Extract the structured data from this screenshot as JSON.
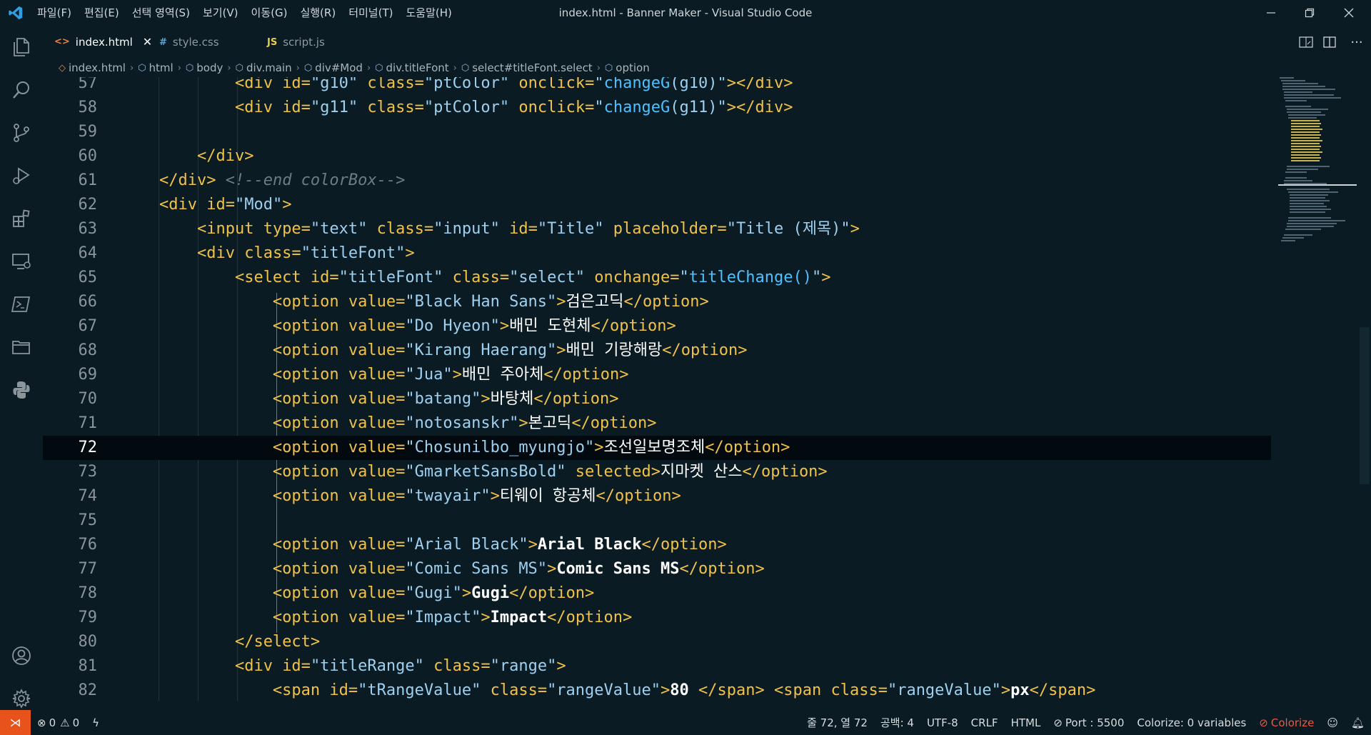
{
  "titlebar": {
    "menu": [
      "파일(F)",
      "편집(E)",
      "선택 영역(S)",
      "보기(V)",
      "이동(G)",
      "실행(R)",
      "터미널(T)",
      "도움말(H)"
    ],
    "title": "index.html - Banner Maker - Visual Studio Code"
  },
  "tabs": [
    {
      "label": "index.html",
      "icon": "<>",
      "active": true,
      "icon_color": "#e8804a"
    },
    {
      "label": "style.css",
      "icon": "#",
      "active": false,
      "icon_color": "#5aa7d6"
    },
    {
      "label": "script.js",
      "icon": "JS",
      "active": false,
      "icon_color": "#e8cf4d"
    }
  ],
  "breadcrumb": [
    "index.html",
    "html",
    "body",
    "div.main",
    "div#Mod",
    "div.titleFont",
    "select#titleFont.select",
    "option"
  ],
  "editor": {
    "current_line": "72",
    "lines": [
      {
        "n": "57",
        "c": [
          [
            "t-txt",
            "            "
          ],
          [
            "t-tag",
            "<div "
          ],
          [
            "t-attr",
            "id="
          ],
          [
            "t-str",
            "\"g10\""
          ],
          [
            "t-attr",
            " class="
          ],
          [
            "t-str",
            "\"ptColor\""
          ],
          [
            "t-attr",
            " onclick="
          ],
          [
            "t-str",
            "\""
          ],
          [
            "t-fn",
            "changeG"
          ],
          [
            "t-str",
            "(g10)\""
          ],
          [
            "t-tag",
            "></div>"
          ]
        ]
      },
      {
        "n": "58",
        "c": [
          [
            "t-txt",
            "            "
          ],
          [
            "t-tag",
            "<div "
          ],
          [
            "t-attr",
            "id="
          ],
          [
            "t-str",
            "\"g11\""
          ],
          [
            "t-attr",
            " class="
          ],
          [
            "t-str",
            "\"ptColor\""
          ],
          [
            "t-attr",
            " onclick="
          ],
          [
            "t-str",
            "\""
          ],
          [
            "t-fn",
            "changeG"
          ],
          [
            "t-str",
            "(g11)\""
          ],
          [
            "t-tag",
            "></div>"
          ]
        ]
      },
      {
        "n": "59",
        "c": []
      },
      {
        "n": "60",
        "c": [
          [
            "t-txt",
            "        "
          ],
          [
            "t-tag",
            "</div>"
          ]
        ]
      },
      {
        "n": "61",
        "c": [
          [
            "t-txt",
            "    "
          ],
          [
            "t-tag",
            "</div>"
          ],
          [
            "t-txt",
            " "
          ],
          [
            "t-com",
            "<!--end colorBox-->"
          ]
        ]
      },
      {
        "n": "62",
        "c": [
          [
            "t-txt",
            "    "
          ],
          [
            "t-tag",
            "<div "
          ],
          [
            "t-attr",
            "id="
          ],
          [
            "t-str",
            "\"Mod\""
          ],
          [
            "t-tag",
            ">"
          ]
        ]
      },
      {
        "n": "63",
        "c": [
          [
            "t-txt",
            "        "
          ],
          [
            "t-tag",
            "<input "
          ],
          [
            "t-attr",
            "type="
          ],
          [
            "t-str",
            "\"text\""
          ],
          [
            "t-attr",
            " class="
          ],
          [
            "t-str",
            "\"input\""
          ],
          [
            "t-attr",
            " id="
          ],
          [
            "t-str",
            "\"Title\""
          ],
          [
            "t-attr",
            " placeholder="
          ],
          [
            "t-str",
            "\"Title (제목)\""
          ],
          [
            "t-tag",
            ">"
          ]
        ]
      },
      {
        "n": "64",
        "c": [
          [
            "t-txt",
            "        "
          ],
          [
            "t-tag",
            "<div "
          ],
          [
            "t-attr",
            "class="
          ],
          [
            "t-str",
            "\"titleFont\""
          ],
          [
            "t-tag",
            ">"
          ]
        ]
      },
      {
        "n": "65",
        "c": [
          [
            "t-txt",
            "            "
          ],
          [
            "t-tag",
            "<select "
          ],
          [
            "t-attr",
            "id="
          ],
          [
            "t-str",
            "\"titleFont\""
          ],
          [
            "t-attr",
            " class="
          ],
          [
            "t-str",
            "\"select\""
          ],
          [
            "t-attr",
            " onchange="
          ],
          [
            "t-str",
            "\""
          ],
          [
            "t-fn",
            "titleChange()"
          ],
          [
            "t-str",
            "\""
          ],
          [
            "t-tag",
            ">"
          ]
        ]
      },
      {
        "n": "66",
        "c": [
          [
            "t-txt",
            "                "
          ],
          [
            "t-tag",
            "<option "
          ],
          [
            "t-attr",
            "value="
          ],
          [
            "t-str",
            "\"Black Han Sans\""
          ],
          [
            "t-tag",
            ">"
          ],
          [
            "t-txt",
            "검은고딕"
          ],
          [
            "t-tag",
            "</option>"
          ]
        ]
      },
      {
        "n": "67",
        "c": [
          [
            "t-txt",
            "                "
          ],
          [
            "t-tag",
            "<option "
          ],
          [
            "t-attr",
            "value="
          ],
          [
            "t-str",
            "\"Do Hyeon\""
          ],
          [
            "t-tag",
            ">"
          ],
          [
            "t-txt",
            "배민 도현체"
          ],
          [
            "t-tag",
            "</option>"
          ]
        ]
      },
      {
        "n": "68",
        "c": [
          [
            "t-txt",
            "                "
          ],
          [
            "t-tag",
            "<option "
          ],
          [
            "t-attr",
            "value="
          ],
          [
            "t-str",
            "\"Kirang Haerang\""
          ],
          [
            "t-tag",
            ">"
          ],
          [
            "t-txt",
            "배민 기랑해랑"
          ],
          [
            "t-tag",
            "</option>"
          ]
        ]
      },
      {
        "n": "69",
        "c": [
          [
            "t-txt",
            "                "
          ],
          [
            "t-tag",
            "<option "
          ],
          [
            "t-attr",
            "value="
          ],
          [
            "t-str",
            "\"Jua\""
          ],
          [
            "t-tag",
            ">"
          ],
          [
            "t-txt",
            "배민 주아체"
          ],
          [
            "t-tag",
            "</option>"
          ]
        ]
      },
      {
        "n": "70",
        "c": [
          [
            "t-txt",
            "                "
          ],
          [
            "t-tag",
            "<option "
          ],
          [
            "t-attr",
            "value="
          ],
          [
            "t-str",
            "\"batang\""
          ],
          [
            "t-tag",
            ">"
          ],
          [
            "t-txt",
            "바탕체"
          ],
          [
            "t-tag",
            "</option>"
          ]
        ]
      },
      {
        "n": "71",
        "c": [
          [
            "t-txt",
            "                "
          ],
          [
            "t-tag",
            "<option "
          ],
          [
            "t-attr",
            "value="
          ],
          [
            "t-str",
            "\"notosanskr\""
          ],
          [
            "t-tag",
            ">"
          ],
          [
            "t-txt",
            "본고딕"
          ],
          [
            "t-tag",
            "</option>"
          ]
        ]
      },
      {
        "n": "72",
        "c": [
          [
            "t-txt",
            "                "
          ],
          [
            "t-tag",
            "<option "
          ],
          [
            "t-attr",
            "value="
          ],
          [
            "t-str",
            "\"Chosunilbo_myungjo\""
          ],
          [
            "t-tag",
            ">"
          ],
          [
            "t-txt",
            "조선일보명조체"
          ],
          [
            "t-tag",
            "</option>"
          ]
        ]
      },
      {
        "n": "73",
        "c": [
          [
            "t-txt",
            "                "
          ],
          [
            "t-tag",
            "<option "
          ],
          [
            "t-attr",
            "value="
          ],
          [
            "t-str",
            "\"GmarketSansBold\""
          ],
          [
            "t-attr",
            " selected"
          ],
          [
            "t-tag",
            ">"
          ],
          [
            "t-txt",
            "지마켓 산스"
          ],
          [
            "t-tag",
            "</option>"
          ]
        ]
      },
      {
        "n": "74",
        "c": [
          [
            "t-txt",
            "                "
          ],
          [
            "t-tag",
            "<option "
          ],
          [
            "t-attr",
            "value="
          ],
          [
            "t-str",
            "\"twayair\""
          ],
          [
            "t-tag",
            ">"
          ],
          [
            "t-txt",
            "티웨이 항공체"
          ],
          [
            "t-tag",
            "</option>"
          ]
        ]
      },
      {
        "n": "75",
        "c": []
      },
      {
        "n": "76",
        "c": [
          [
            "t-txt",
            "                "
          ],
          [
            "t-tag",
            "<option "
          ],
          [
            "t-attr",
            "value="
          ],
          [
            "t-str",
            "\"Arial Black\""
          ],
          [
            "t-tag",
            ">"
          ],
          [
            "t-b",
            "Arial Black"
          ],
          [
            "t-tag",
            "</option>"
          ]
        ]
      },
      {
        "n": "77",
        "c": [
          [
            "t-txt",
            "                "
          ],
          [
            "t-tag",
            "<option "
          ],
          [
            "t-attr",
            "value="
          ],
          [
            "t-str",
            "\"Comic Sans MS\""
          ],
          [
            "t-tag",
            ">"
          ],
          [
            "t-b",
            "Comic Sans MS"
          ],
          [
            "t-tag",
            "</option>"
          ]
        ]
      },
      {
        "n": "78",
        "c": [
          [
            "t-txt",
            "                "
          ],
          [
            "t-tag",
            "<option "
          ],
          [
            "t-attr",
            "value="
          ],
          [
            "t-str",
            "\"Gugi\""
          ],
          [
            "t-tag",
            ">"
          ],
          [
            "t-b",
            "Gugi"
          ],
          [
            "t-tag",
            "</option>"
          ]
        ]
      },
      {
        "n": "79",
        "c": [
          [
            "t-txt",
            "                "
          ],
          [
            "t-tag",
            "<option "
          ],
          [
            "t-attr",
            "value="
          ],
          [
            "t-str",
            "\"Impact\""
          ],
          [
            "t-tag",
            ">"
          ],
          [
            "t-b",
            "Impact"
          ],
          [
            "t-tag",
            "</option>"
          ]
        ]
      },
      {
        "n": "80",
        "c": [
          [
            "t-txt",
            "            "
          ],
          [
            "t-tag",
            "</select>"
          ]
        ]
      },
      {
        "n": "81",
        "c": [
          [
            "t-txt",
            "            "
          ],
          [
            "t-tag",
            "<div "
          ],
          [
            "t-attr",
            "id="
          ],
          [
            "t-str",
            "\"titleRange\""
          ],
          [
            "t-attr",
            " class="
          ],
          [
            "t-str",
            "\"range\""
          ],
          [
            "t-tag",
            ">"
          ]
        ]
      },
      {
        "n": "82",
        "c": [
          [
            "t-txt",
            "                "
          ],
          [
            "t-tag",
            "<span "
          ],
          [
            "t-attr",
            "id="
          ],
          [
            "t-str",
            "\"tRangeValue\""
          ],
          [
            "t-attr",
            " class="
          ],
          [
            "t-str",
            "\"rangeValue\""
          ],
          [
            "t-tag",
            ">"
          ],
          [
            "t-b",
            "80 "
          ],
          [
            "t-tag",
            "</span>"
          ],
          [
            "t-txt",
            " "
          ],
          [
            "t-tag",
            "<span "
          ],
          [
            "t-attr",
            "class="
          ],
          [
            "t-str",
            "\"rangeValue\""
          ],
          [
            "t-tag",
            ">"
          ],
          [
            "t-b",
            "px"
          ],
          [
            "t-tag",
            "</span>"
          ]
        ]
      }
    ]
  },
  "statusbar": {
    "errors": "0",
    "warnings": "0",
    "position": "줄 72, 열 72",
    "spaces": "공백: 4",
    "encoding": "UTF-8",
    "eol": "CRLF",
    "language": "HTML",
    "port": "Port : 5500",
    "colorize_vars": "Colorize: 0 variables",
    "colorize": "Colorize"
  },
  "colors": {
    "background": "#0a1b23",
    "tag": "#f0c247",
    "string": "#9ed0f0",
    "function": "#4fc1ff",
    "remote": "#e8521b",
    "colorize_warn": "#f0583d"
  }
}
